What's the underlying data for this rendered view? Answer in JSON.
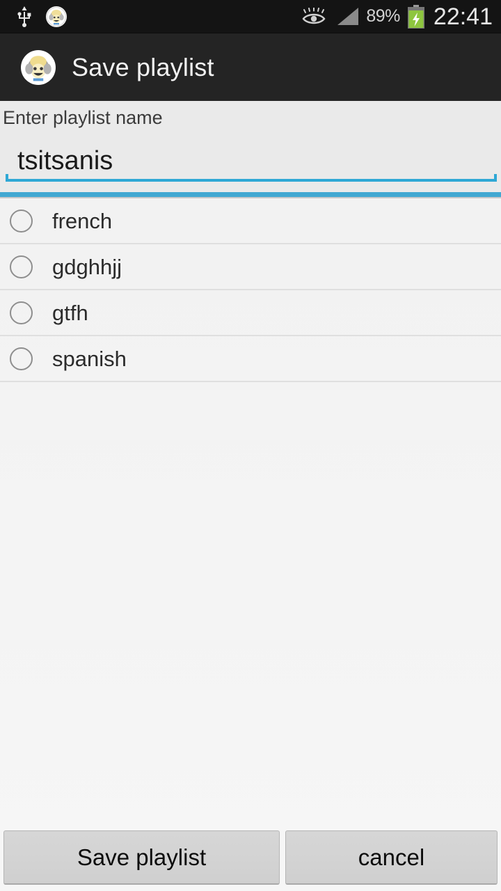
{
  "status_bar": {
    "usb_icon": "usb-icon",
    "app_notification_icon": "app-notification-icon",
    "smart_stay_icon": "eye-icon",
    "signal_icon": "signal-bars-icon",
    "battery_percent": "89%",
    "battery_icon": "battery-charging-icon",
    "clock": "22:41"
  },
  "action_bar": {
    "icon": "app-logo-icon",
    "title": "Save playlist"
  },
  "form": {
    "label": "Enter playlist name",
    "input_value": "tsitsanis",
    "input_placeholder": "Enter playlist name"
  },
  "playlists": [
    {
      "label": "french",
      "selected": false
    },
    {
      "label": "gdghhjj",
      "selected": false
    },
    {
      "label": "gtfh",
      "selected": false
    },
    {
      "label": "spanish",
      "selected": false
    }
  ],
  "buttons": {
    "save_label": "Save playlist",
    "cancel_label": "cancel"
  },
  "colors": {
    "accent_blue": "#41a8d2",
    "input_underline": "#2fa8d5",
    "status_bar_bg": "#141414",
    "action_bar_bg": "#242424",
    "page_bg": "#f3f3f3",
    "battery_green": "#8ec63f"
  }
}
